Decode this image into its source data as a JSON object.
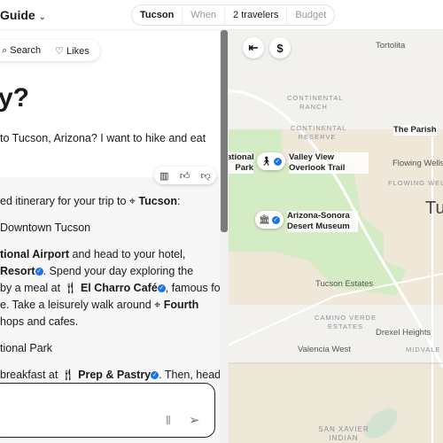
{
  "header": {
    "title": "Guide",
    "filters": [
      "Tucson",
      "When",
      "2 travelers",
      "Budget"
    ]
  },
  "tabs": {
    "search": "Search",
    "likes": "Likes"
  },
  "chat": {
    "heading": "y?",
    "question": "to Tucson, Arizona? I want to hike and eat",
    "answer": {
      "intro": "ed itinerary for your trip to",
      "intro_place": "Tucson",
      "day1": "Downtown Tucson",
      "l1a": "tional Airport",
      "l1b": " and head to your hotel,",
      "l2a": "Resort",
      "l2b": ". Spend your day exploring the",
      "l3a": "by a meal at ",
      "l3b": "El Charro Café",
      "l3c": ", famous for",
      "l4a": "e. Take a leisurely walk around ",
      "l4b": "Fourth",
      "l5": "hops and cafes.",
      "day2": "tional Park",
      "l6a": "breakfast at ",
      "l6b": "Prep & Pastry",
      "l6c": ". Then, head"
    }
  },
  "map": {
    "places": [
      "Tortolita",
      "Flowing Wells",
      "Tucson Estates",
      "Drexel Heights",
      "Valencia West",
      "Tu"
    ],
    "areas": [
      "CONTINENTAL RANCH",
      "CONTINENTAL RESERVE",
      "FLOWING WELLS",
      "CAMINO VERDE ESTATES",
      "MIDVALE PA",
      "SAN XAVIER INDIAN RESERVATION"
    ],
    "pois": {
      "parish": "The Parish",
      "park": "ational Park",
      "trail": "Valley View Overlook Trail",
      "museum": "Arizona-Sonora Desert Museum"
    },
    "colors": {
      "park": "#d4ecc4",
      "desert": "#efe8d8",
      "base": "#f2f1ee",
      "verified": "#1a73e8"
    }
  }
}
